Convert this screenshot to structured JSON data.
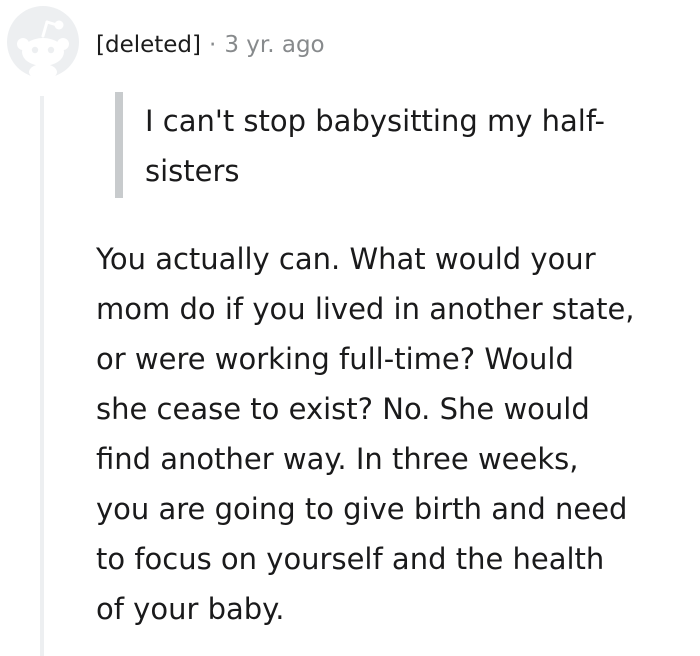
{
  "comment": {
    "avatar_icon": "snoo-avatar-icon",
    "author": "[deleted]",
    "separator": "·",
    "time": "3 yr. ago",
    "quote_lines": [
      "I can't stop babysitting my half-",
      "sisters"
    ],
    "body_lines": [
      "You actually can. What would your",
      "mom do if you lived in another state,",
      "or were working full-time? Would",
      "she cease to exist? No. She would",
      "find another way. In three weeks,",
      "you are going to give birth and need",
      "to focus on yourself and the health",
      "of your baby."
    ]
  },
  "colors": {
    "avatar_bg": "#edeff1",
    "avatar_fg": "#ffffff",
    "meta_gray": "#878a8c",
    "quote_bar": "#c8cbcd",
    "thread_line": "#edeff1",
    "text": "#1a1a1b"
  }
}
